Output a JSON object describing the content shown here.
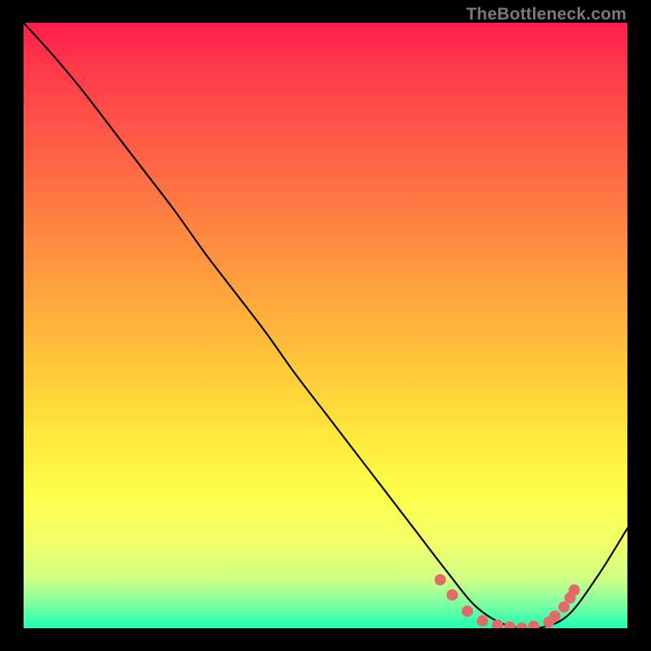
{
  "watermark": "TheBottleneck.com",
  "chart_data": {
    "type": "line",
    "title": "",
    "xlabel": "",
    "ylabel": "",
    "xlim": [
      0,
      1
    ],
    "ylim": [
      0,
      1
    ],
    "series": [
      {
        "name": "curve",
        "color": "#000000",
        "x": [
          0.0,
          0.05,
          0.1,
          0.15,
          0.2,
          0.25,
          0.3,
          0.35,
          0.4,
          0.45,
          0.5,
          0.55,
          0.6,
          0.65,
          0.7,
          0.75,
          0.8,
          0.85,
          0.9,
          0.95,
          1.0
        ],
        "values": [
          1.0,
          0.945,
          0.885,
          0.82,
          0.755,
          0.69,
          0.62,
          0.555,
          0.49,
          0.42,
          0.355,
          0.29,
          0.225,
          0.16,
          0.095,
          0.035,
          0.005,
          0.0,
          0.02,
          0.085,
          0.165
        ]
      }
    ],
    "markers": {
      "name": "highlight-dots",
      "color": "#e46a6a",
      "x": [
        0.69,
        0.71,
        0.735,
        0.76,
        0.785,
        0.805,
        0.825,
        0.845,
        0.87,
        0.88,
        0.895,
        0.905,
        0.912
      ],
      "values": [
        0.08,
        0.055,
        0.028,
        0.012,
        0.005,
        0.002,
        0.0,
        0.003,
        0.01,
        0.02,
        0.035,
        0.05,
        0.063
      ]
    }
  }
}
